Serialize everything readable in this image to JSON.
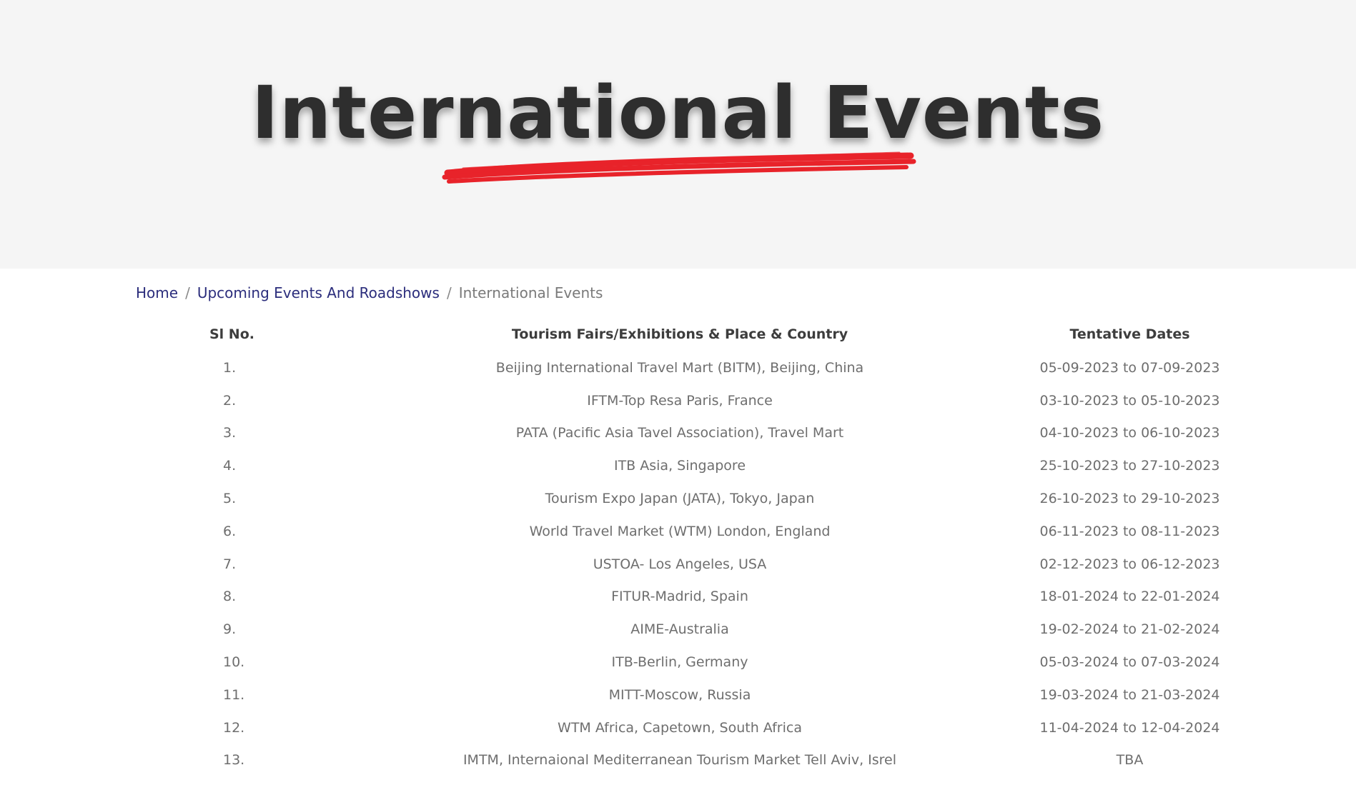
{
  "hero": {
    "title": "International Events",
    "accent_color": "#e8232a"
  },
  "breadcrumb": {
    "items": [
      {
        "label": "Home"
      },
      {
        "label": "Upcoming Events And Roadshows"
      }
    ],
    "separator": "/",
    "current": "International Events"
  },
  "table": {
    "headers": {
      "sl": "Sl No.",
      "name": "Tourism Fairs/Exhibitions & Place & Country",
      "dates": "Tentative Dates"
    },
    "rows": [
      {
        "sl": "1.",
        "name": "Beijing International Travel Mart (BITM), Beijing, China",
        "dates": "05-09-2023 to 07-09-2023"
      },
      {
        "sl": "2.",
        "name": "IFTM-Top Resa Paris, France",
        "dates": "03-10-2023 to 05-10-2023"
      },
      {
        "sl": "3.",
        "name": "PATA (Pacific Asia Tavel Association), Travel Mart",
        "dates": "04-10-2023 to 06-10-2023"
      },
      {
        "sl": "4.",
        "name": "ITB Asia, Singapore",
        "dates": "25-10-2023 to 27-10-2023"
      },
      {
        "sl": "5.",
        "name": "Tourism Expo Japan (JATA), Tokyo, Japan",
        "dates": "26-10-2023 to 29-10-2023"
      },
      {
        "sl": "6.",
        "name": "World Travel Market (WTM) London, England",
        "dates": "06-11-2023 to 08-11-2023"
      },
      {
        "sl": "7.",
        "name": "USTOA- Los Angeles, USA",
        "dates": "02-12-2023 to 06-12-2023"
      },
      {
        "sl": "8.",
        "name": "FITUR-Madrid, Spain",
        "dates": "18-01-2024 to 22-01-2024"
      },
      {
        "sl": "9.",
        "name": "AIME-Australia",
        "dates": "19-02-2024 to 21-02-2024"
      },
      {
        "sl": "10.",
        "name": "ITB-Berlin, Germany",
        "dates": "05-03-2024 to 07-03-2024"
      },
      {
        "sl": "11.",
        "name": "MITT-Moscow, Russia",
        "dates": "19-03-2024 to 21-03-2024"
      },
      {
        "sl": "12.",
        "name": "WTM Africa, Capetown, South Africa",
        "dates": "11-04-2024 to 12-04-2024"
      },
      {
        "sl": "13.",
        "name": "IMTM, Internaional Mediterranean Tourism Market Tell Aviv, Isrel",
        "dates": "TBA"
      }
    ]
  }
}
